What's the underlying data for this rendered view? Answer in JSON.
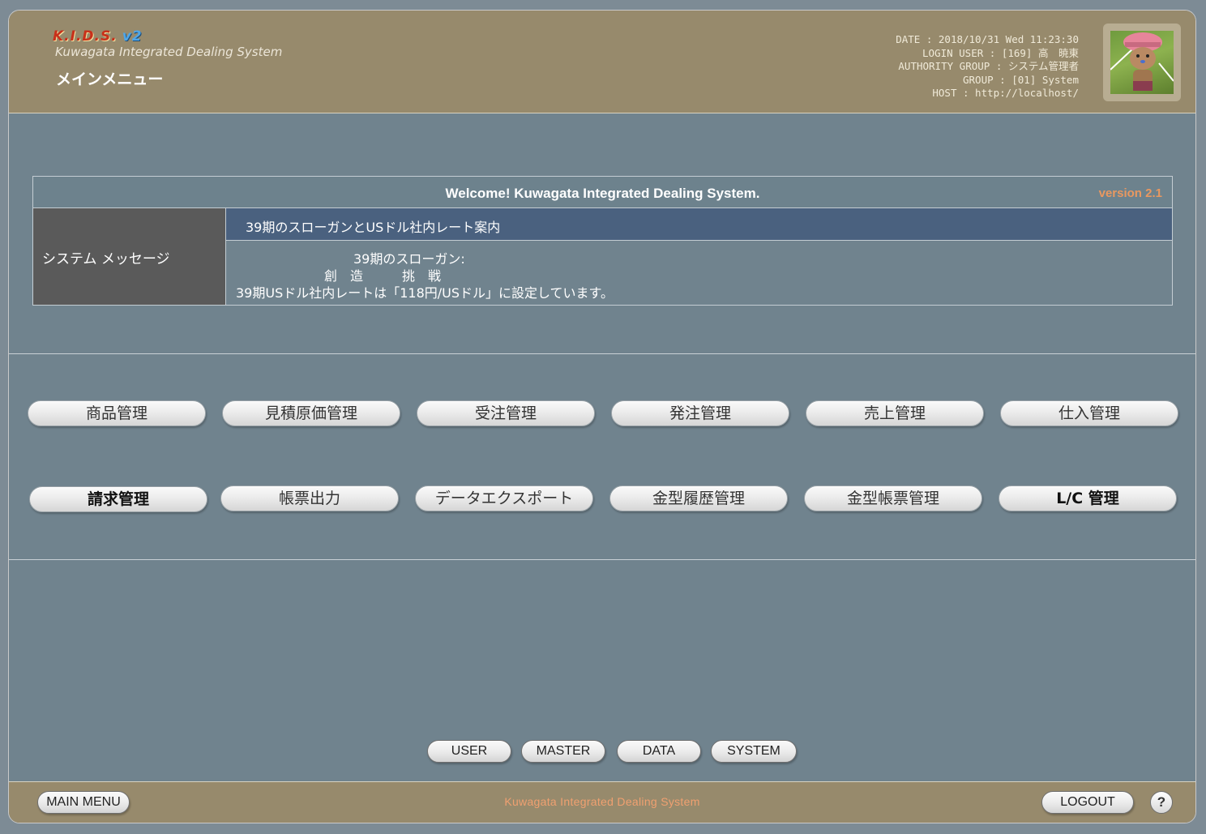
{
  "header": {
    "logo_text": "K.I.D.S.",
    "logo_version": "v2",
    "logo_subtitle": "Kuwagata Integrated Dealing System",
    "page_title": "メインメニュー",
    "info": {
      "date": "DATE : 2018/10/31 Wed 11:23:30",
      "login_user": "LOGIN USER : [169] 高　暁東",
      "authority_group": "AUTHORITY GROUP : システム管理者",
      "group": "GROUP : [01] System",
      "host": "HOST : http://localhost/"
    }
  },
  "messages": {
    "welcome": "Welcome! Kuwagata Integrated Dealing System.",
    "version": "version 2.1",
    "side_label": "システム メッセージ",
    "subject": "39期のスローガンとUSドル社内レート案内",
    "body_line1": "39期のスローガン:",
    "body_line2": "創　造　　　挑　戦",
    "body_line3": "39期USドル社内レートは「118円/USドル」に設定しています。"
  },
  "menu": {
    "row1": [
      "商品管理",
      "見積原価管理",
      "受注管理",
      "発注管理",
      "売上管理",
      "仕入管理"
    ],
    "row2": [
      "請求管理",
      "帳票出力",
      "データエクスポート",
      "金型履歴管理",
      "金型帳票管理",
      "L/C 管理"
    ]
  },
  "admin": {
    "user": "USER",
    "master": "MASTER",
    "data": "DATA",
    "system": "SYSTEM"
  },
  "footer": {
    "main_menu": "MAIN MENU",
    "system_name": "Kuwagata Integrated Dealing System",
    "logout": "LOGOUT",
    "help": "?"
  },
  "colors": {
    "header_bg": "#978a6c",
    "body_bg": "#70838e",
    "subject_bg": "#4a617f",
    "version_accent": "#e99860"
  }
}
